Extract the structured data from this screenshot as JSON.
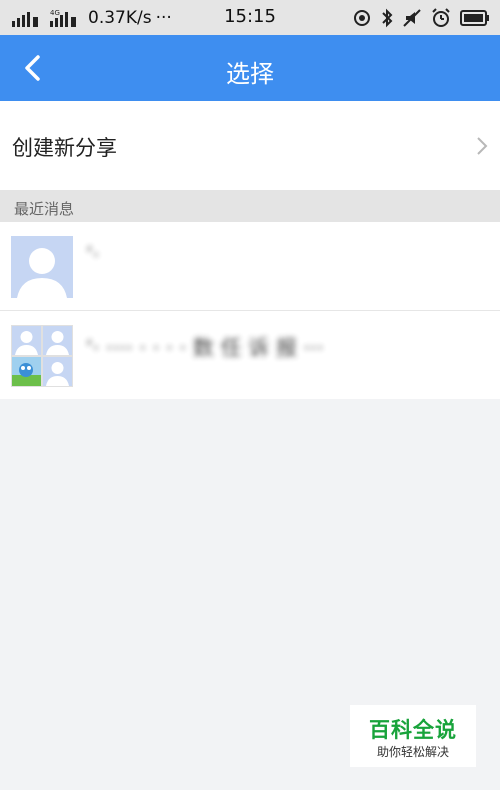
{
  "status_bar": {
    "network_speed": "0.37K/s",
    "dots": "···",
    "time": "15:15",
    "icons": [
      "signal-icon",
      "signal-4g-icon",
      "location-icon",
      "bluetooth-icon",
      "mute-icon",
      "alarm-icon",
      "battery-icon"
    ]
  },
  "navbar": {
    "title": "选择",
    "back_icon": "back-arrow-icon"
  },
  "create_row": {
    "label": "创建新分享",
    "chevron_icon": "chevron-right-icon"
  },
  "section": {
    "label": "最近消息"
  },
  "conversations": [
    {
      "name": "’·",
      "avatar": "person-avatar"
    },
    {
      "name": "‘·  ····  · ·  ·  · 数 任 诉 报  ···",
      "avatar": "group-avatar"
    }
  ],
  "watermark": {
    "title": "百科全说",
    "subtitle": "助你轻松解决"
  },
  "colors": {
    "navbar": "#3e8ef0",
    "background": "#f2f3f5",
    "watermark_green": "#18a33b"
  }
}
